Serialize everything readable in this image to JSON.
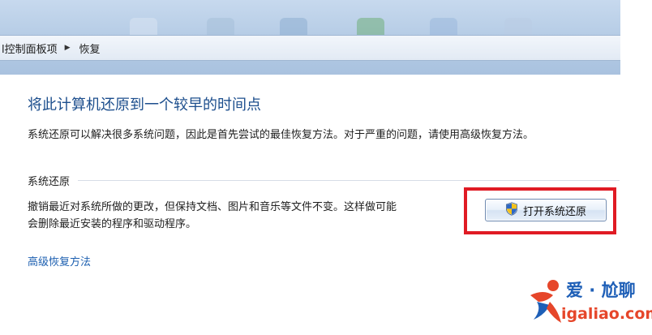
{
  "breadcrumb": {
    "items": [
      "l控制面板项",
      "恢复"
    ],
    "separator": "▶"
  },
  "content": {
    "title": "将此计算机还原到一个较早的时间点",
    "description": "系统还原可以解决很多系统问题，因此是首先尝试的最佳恢复方法。对于严重的问题，请使用高级恢复方法。"
  },
  "system_restore": {
    "heading": "系统还原",
    "text_line1": "撤销最近对系统所做的更改，但保持文档、图片和音乐等文件不变。这样做可能",
    "text_line2": "会删除最近安装的程序和驱动程序。",
    "button_label": "打开系统还原",
    "button_icon": "uac-shield-icon"
  },
  "links": {
    "advanced": "高级恢复方法"
  },
  "watermark": {
    "name": "爱 · 尬聊",
    "url": "igaliao.com"
  },
  "colors": {
    "title": "#1c4e8d",
    "link": "#1c5fb0",
    "highlight_border": "#e01b24",
    "watermark_blue": "#1e5fb7",
    "watermark_orange": "#e6462a"
  }
}
